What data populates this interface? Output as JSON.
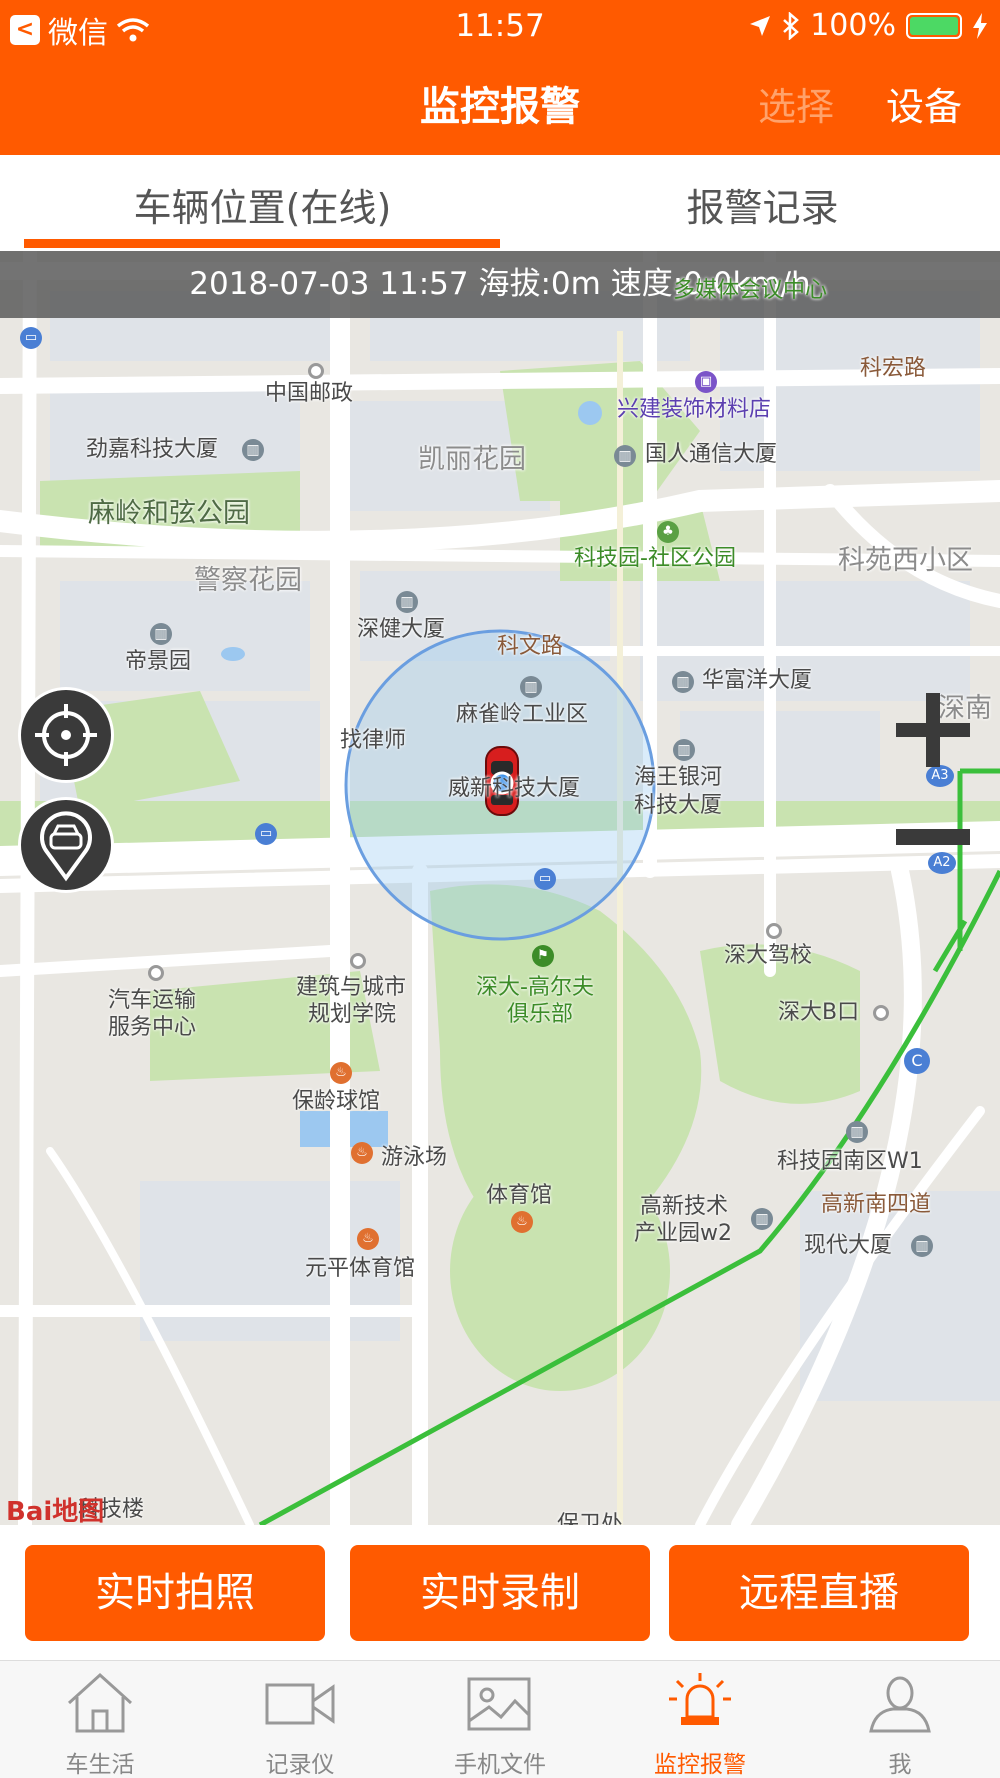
{
  "status_bar": {
    "back_app": "微信",
    "time": "11:57",
    "battery": "100%"
  },
  "header": {
    "title": "监控报警",
    "select": "选择",
    "device": "设备"
  },
  "tabs": [
    {
      "label": "车辆位置(在线)"
    },
    {
      "label": "报警记录"
    }
  ],
  "map": {
    "info": "2018-07-03 11:57  海拔:0m  速度:0.0km/h",
    "pois": [
      "多媒体会议中心",
      "科宏路",
      "中国邮政",
      "兴建装饰材料店",
      "劲嘉科技大厦",
      "凯丽花园",
      "国人通信大厦",
      "麻岭和弦公园",
      "科技园-社区公园",
      "科苑西小区",
      "警察花园",
      "深健大厦",
      "科文路",
      "帝景园",
      "华富洋大厦",
      "麻雀岭工业区",
      "深南",
      "找律师",
      "威新科技大厦",
      "海王银河",
      "科技大厦",
      "深大驾校",
      "建筑与城市",
      "规划学院",
      "深大-高尔夫",
      "俱乐部",
      "汽车运输",
      "服务中心",
      "深大B口",
      "保龄球馆",
      "游泳场",
      "科技园南区W1",
      "体育馆",
      "高新技术",
      "产业园w2",
      "高新南四道",
      "现代大厦",
      "元平体育馆",
      "保卫处",
      "科技楼"
    ],
    "road_badges": [
      "A3",
      "A2",
      "C"
    ],
    "logo": "Bai地图"
  },
  "actions": {
    "photo": "实时拍照",
    "record": "实时录制",
    "live": "远程直播"
  },
  "tabbar": [
    {
      "label": "车生活",
      "icon": "home-icon"
    },
    {
      "label": "记录仪",
      "icon": "video-camera-icon"
    },
    {
      "label": "手机文件",
      "icon": "image-icon"
    },
    {
      "label": "监控报警",
      "icon": "alarm-light-icon",
      "active": true
    },
    {
      "label": "我",
      "icon": "user-icon"
    }
  ],
  "colors": {
    "accent": "#ff5a00",
    "map_bg": "#e9e7e2",
    "park": "#c9e3b0",
    "water": "#9cc8f0"
  }
}
